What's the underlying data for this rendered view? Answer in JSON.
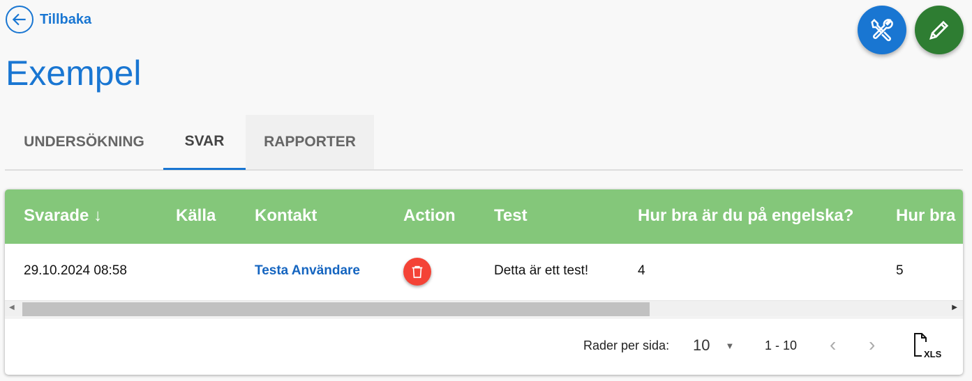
{
  "back": {
    "label": "Tillbaka",
    "icon": "arrow-left-icon"
  },
  "page_title": "Exempel",
  "actions": [
    {
      "icon": "tools-icon",
      "color": "#1976d2"
    },
    {
      "icon": "pencil-icon",
      "color": "#2e7d32"
    }
  ],
  "tabs": [
    {
      "label": "UNDERSÖKNING"
    },
    {
      "label": "SVAR",
      "active": true
    },
    {
      "label": "RAPPORTER"
    }
  ],
  "table": {
    "header_color": "#84c77a",
    "columns": [
      "Svarade",
      "Källa",
      "Kontakt",
      "Action",
      "Test",
      "Hur bra är du på engelska?",
      "Hur bra"
    ],
    "rows": [
      {
        "svarade": "29.10.2024 08:58",
        "kalla": "",
        "kontakt": "Testa Användare",
        "test": "Detta är ett test!",
        "engelska": "4",
        "next": "5"
      }
    ]
  },
  "footer": {
    "rows_per_page_label": "Rader per sida:",
    "rows_per_page": "10",
    "range": "1 - 10",
    "export": "XLS"
  }
}
